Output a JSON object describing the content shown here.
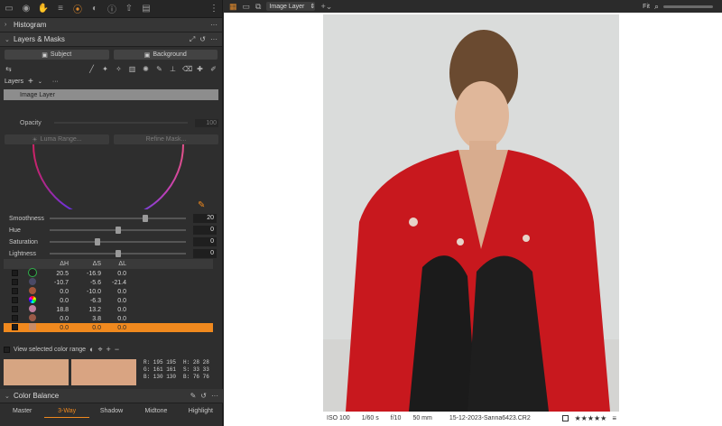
{
  "tools_tabs": [
    "folder-icon",
    "camera-icon",
    "hand-icon",
    "sliders-icon",
    "color-icon",
    "lens-icon",
    "info-icon",
    "export-icon",
    "batch-icon"
  ],
  "histogram": {
    "title": "Histogram"
  },
  "layers_masks": {
    "title": "Layers & Masks",
    "subject_label": "Subject",
    "background_label": "Background",
    "layers_label": "Layers",
    "add_label": "+",
    "selected_layer": "Image Layer",
    "opacity_label": "Opacity",
    "opacity_value": "100",
    "luma_range_label": "Luma Range...",
    "refine_mask_label": "Refine Mask..."
  },
  "color_editor": {
    "sliders": [
      {
        "label": "Smoothness",
        "value": "20",
        "level": 0.7
      },
      {
        "label": "Hue",
        "value": "0",
        "level": 0.5
      },
      {
        "label": "Saturation",
        "value": "0",
        "level": 0.35
      },
      {
        "label": "Lightness",
        "value": "0",
        "level": 0.5
      }
    ],
    "table_headers": [
      "ΔH",
      "ΔS",
      "ΔL"
    ],
    "rows": [
      {
        "swatch": "#1f1f1f",
        "ring": "#2fb14a",
        "dh": "20.5",
        "ds": "-16.9",
        "dl": "0.0"
      },
      {
        "swatch": "#4a4a66",
        "ring": "",
        "dh": "-10.7",
        "ds": "-5.6",
        "dl": "-21.4"
      },
      {
        "swatch": "#a3573a",
        "ring": "",
        "dh": "0.0",
        "ds": "-10.0",
        "dl": "0.0"
      },
      {
        "swatch": "rainbow",
        "ring": "",
        "dh": "0.0",
        "ds": "-6.3",
        "dl": "0.0"
      },
      {
        "swatch": "#c07f9f",
        "ring": "",
        "dh": "18.8",
        "ds": "13.2",
        "dl": "0.0"
      },
      {
        "swatch": "#9b5a48",
        "ring": "",
        "dh": "0.0",
        "ds": "3.8",
        "dl": "0.0"
      },
      {
        "swatch": "#c98b66",
        "ring": "",
        "dh": "0.0",
        "ds": "0.0",
        "dl": "0.0",
        "selected": true
      }
    ],
    "view_range_label": "View selected color range",
    "swatch_color_a": "#d6a582",
    "swatch_color_b": "#d9a482",
    "rgb_left": [
      "R: 195 195",
      "G: 161 161",
      "B: 130 130"
    ],
    "hsb_right": [
      "H:   28   28",
      "S:   33   33",
      "B:   76   76"
    ]
  },
  "color_balance": {
    "title": "Color Balance",
    "tabs": [
      "Master",
      "3-Way",
      "Shadow",
      "Midtone",
      "Highlight"
    ],
    "active_tab": "3-Way"
  },
  "viewer": {
    "layer_select": "Image Layer",
    "fit_label": "Fit",
    "iso": "ISO 100",
    "shutter": "1/60 s",
    "aperture": "f/10",
    "focal": "50 mm",
    "filename": "15-12-2023-Sanna6423.CR2",
    "stars": "★★★★★"
  },
  "colors": {
    "accent": "#f0891e",
    "jacket": "#c8181e",
    "backdrop": "#dcdedd"
  }
}
